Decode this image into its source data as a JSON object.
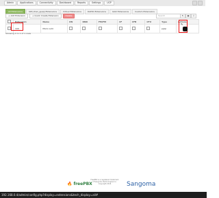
{
  "nav": {
    "items": [
      "Admin",
      "Applications",
      "Connectivity",
      "Dashboard",
      "Reports",
      "Settings",
      "UCP"
    ]
  },
  "tabs": [
    {
      "label": "All Extensions",
      "active": true
    },
    {
      "label": "SIP [chan_pjsip] Extensions",
      "active": false
    },
    {
      "label": "Virtual Extensions",
      "active": false
    },
    {
      "label": "DAHDi Extensions",
      "active": false
    },
    {
      "label": "IAX2 Extensions",
      "active": false
    },
    {
      "label": "Custom Extensions",
      "active": false
    }
  ],
  "toolbar": {
    "add_label": "+ Add Extension",
    "bulk_label": "+ Quick Create Extension",
    "delete_label": "Delete"
  },
  "search": {
    "placeholder": "Search"
  },
  "table": {
    "headers": [
      "",
      "Extension",
      "Name",
      "CW",
      "DND",
      "FM/FM",
      "CF",
      "CFB",
      "CFU",
      "Type",
      "Actions"
    ],
    "rows": [
      {
        "extension": "100",
        "name": "Mario Lutz",
        "type": "pjsip"
      }
    ]
  },
  "pagination": {
    "text": "Showing 1 to 1 of 1 rows"
  },
  "footer": {
    "freepbx": "freePBX",
    "sangoma": "Sangoma",
    "copyright": "FreePBX is a registered trademark of Sangoma Technologies Inc. Copyright 2016"
  },
  "status_bar": "192.168.0.4/admin/config.php?display=extensions&tech_display=all#"
}
